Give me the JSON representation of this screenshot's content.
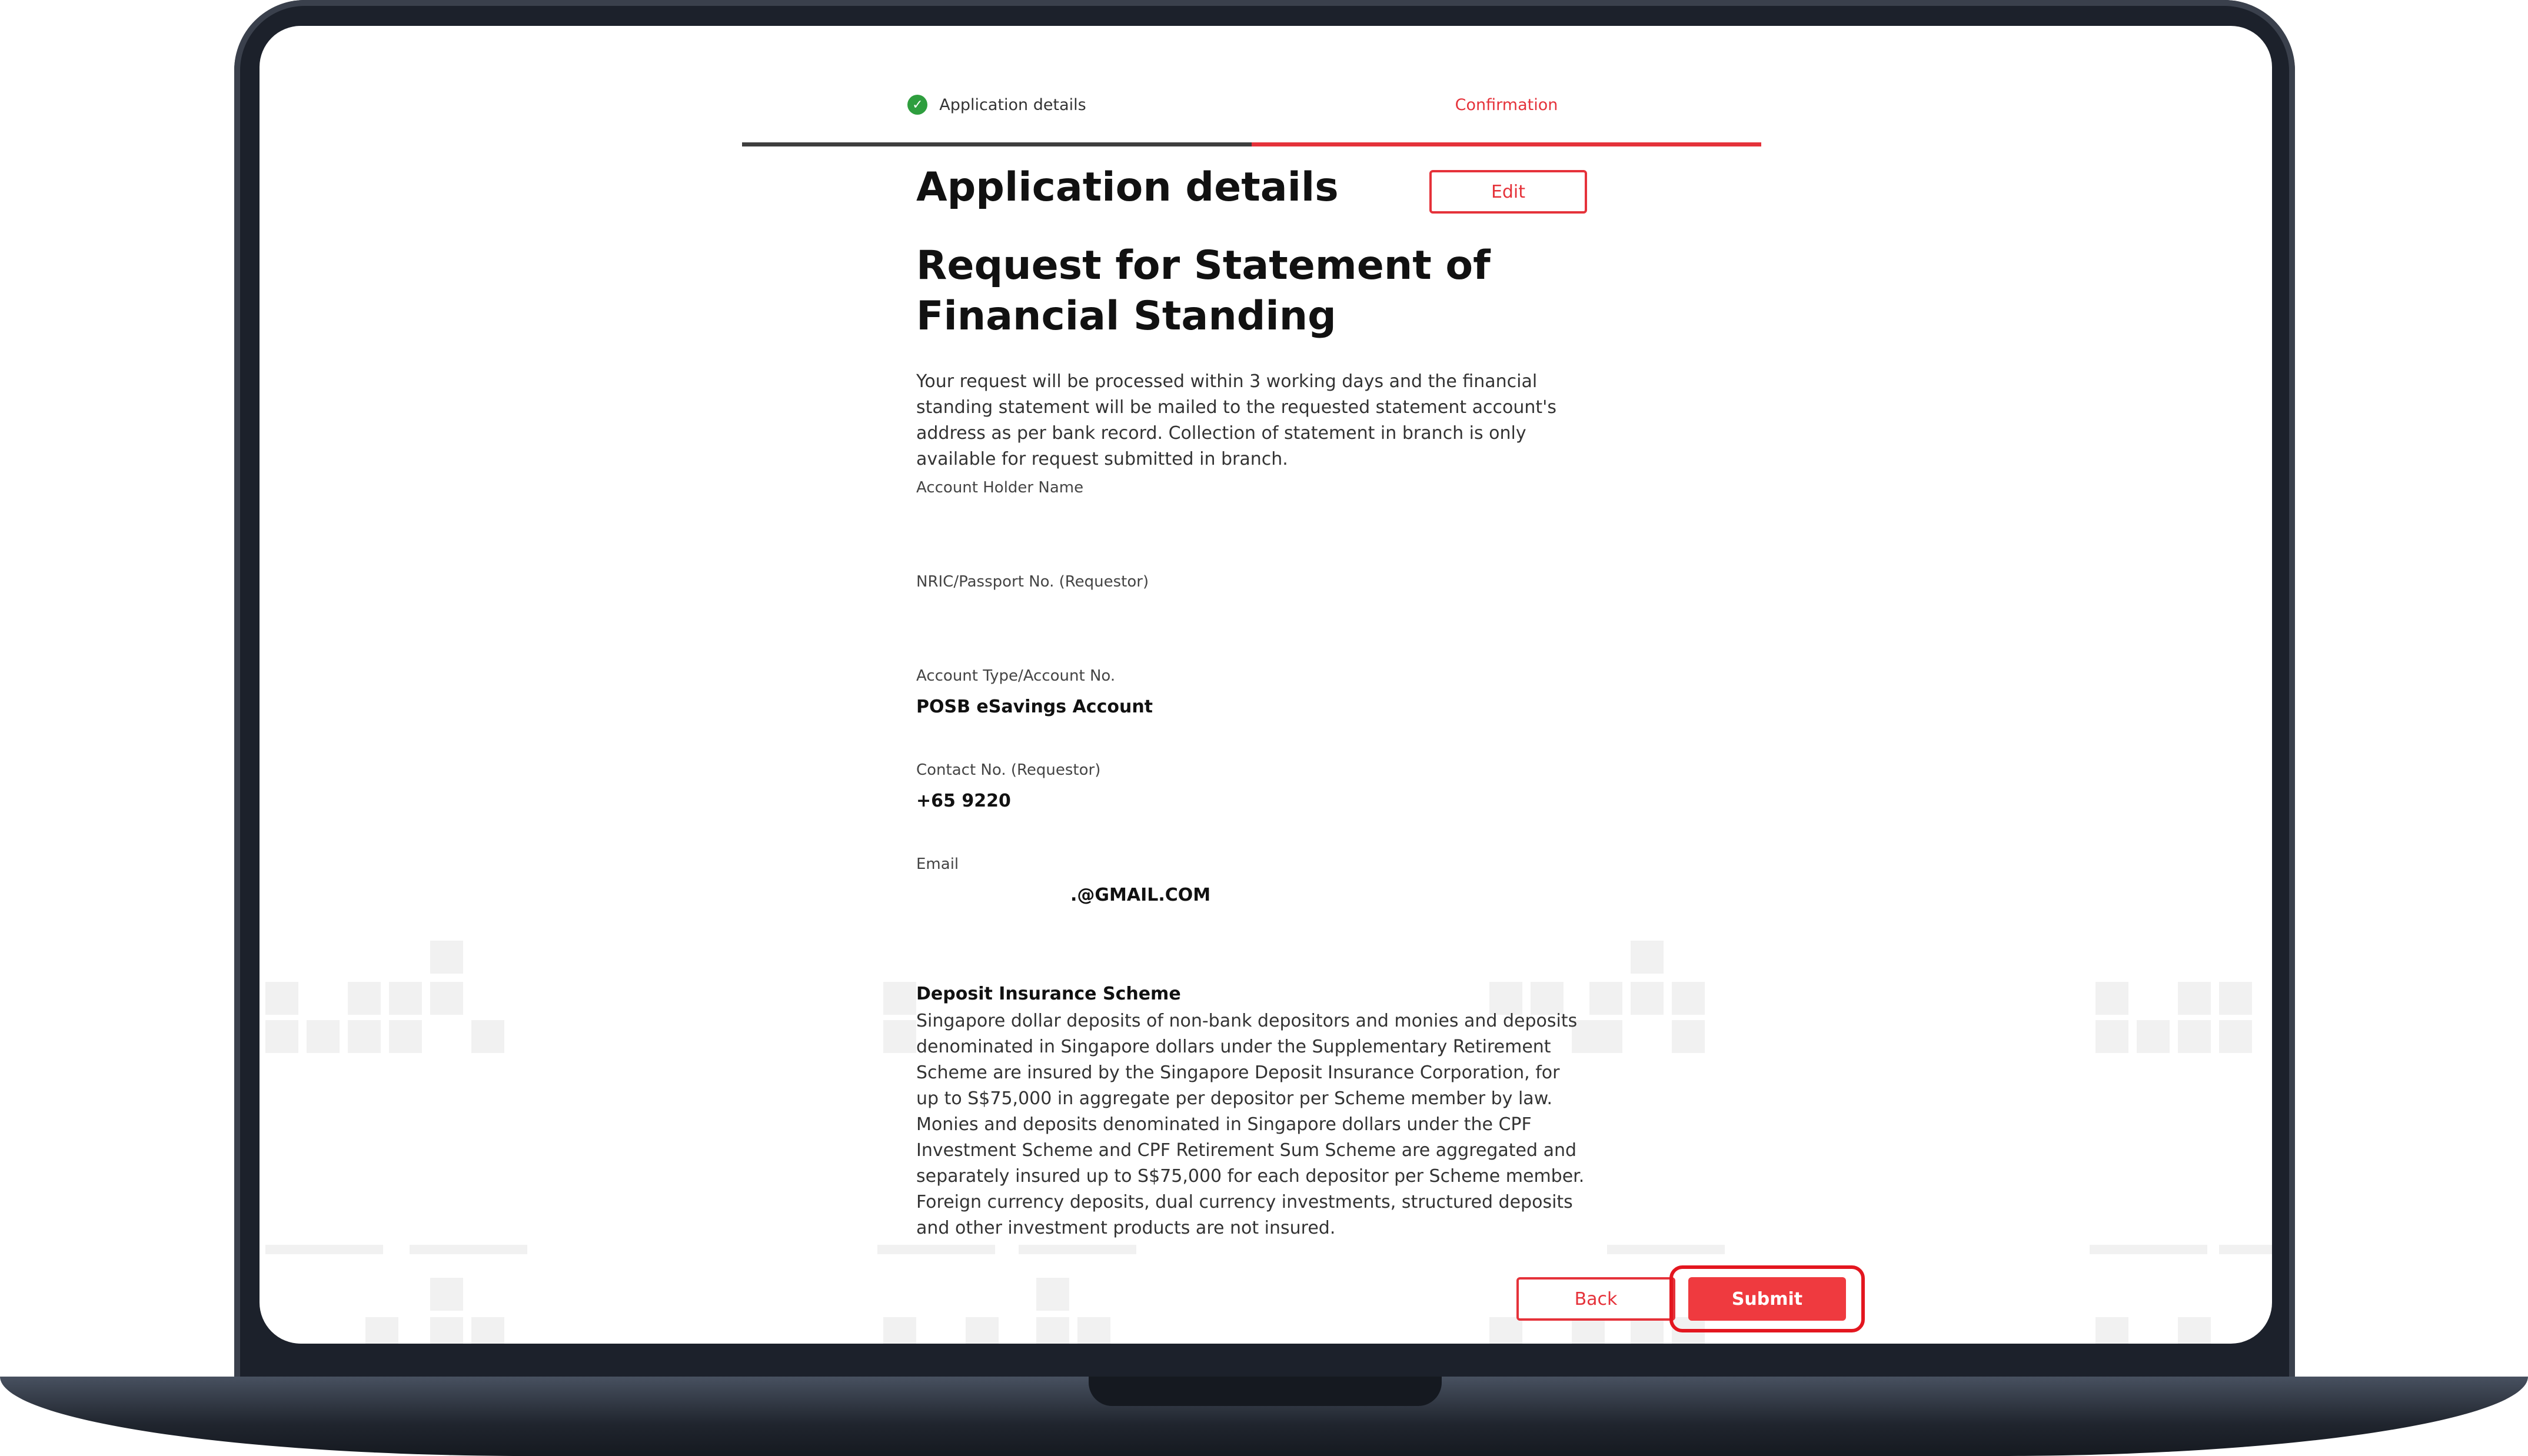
{
  "stepper": {
    "steps": [
      {
        "label": "Application details",
        "status": "complete"
      },
      {
        "label": "Confirmation",
        "status": "current"
      }
    ]
  },
  "header": {
    "title": "Application details",
    "edit_label": "Edit"
  },
  "request": {
    "title": "Request for Statement of Financial Standing",
    "intro": "Your request will be processed within 3 working days and the financial standing statement will be mailed to the requested statement account's address as per bank record. Collection of statement in branch is only available for request submitted in branch."
  },
  "fields": [
    {
      "label": "Account Holder Name",
      "value": ""
    },
    {
      "label": "NRIC/Passport No. (Requestor)",
      "value": ""
    },
    {
      "label": "Account Type/Account No.",
      "value": "POSB eSavings Account"
    },
    {
      "label": "Contact No. (Requestor)",
      "value": "+65 9220"
    },
    {
      "label": "Email",
      "value": ".@GMAIL.COM"
    }
  ],
  "disclaimer": {
    "title": "Deposit Insurance Scheme",
    "text": "Singapore dollar deposits of non-bank depositors and monies and deposits denominated in Singapore dollars under the Supplementary Retirement Scheme are insured by the Singapore Deposit Insurance Corporation, for up to S$75,000 in aggregate per depositor per Scheme member by law. Monies and deposits denominated in Singapore dollars under the CPF Investment Scheme and CPF Retirement Sum Scheme are aggregated and separately insured up to S$75,000 for each depositor per Scheme member. Foreign currency deposits, dual currency investments, structured deposits and other investment products are not insured."
  },
  "actions": {
    "back_label": "Back",
    "submit_label": "Submit"
  },
  "colors": {
    "accent": "#e5323a",
    "success": "#2e9e3e",
    "frame": "#1c212b"
  },
  "icons": {
    "step_complete": "check-circle-icon"
  }
}
